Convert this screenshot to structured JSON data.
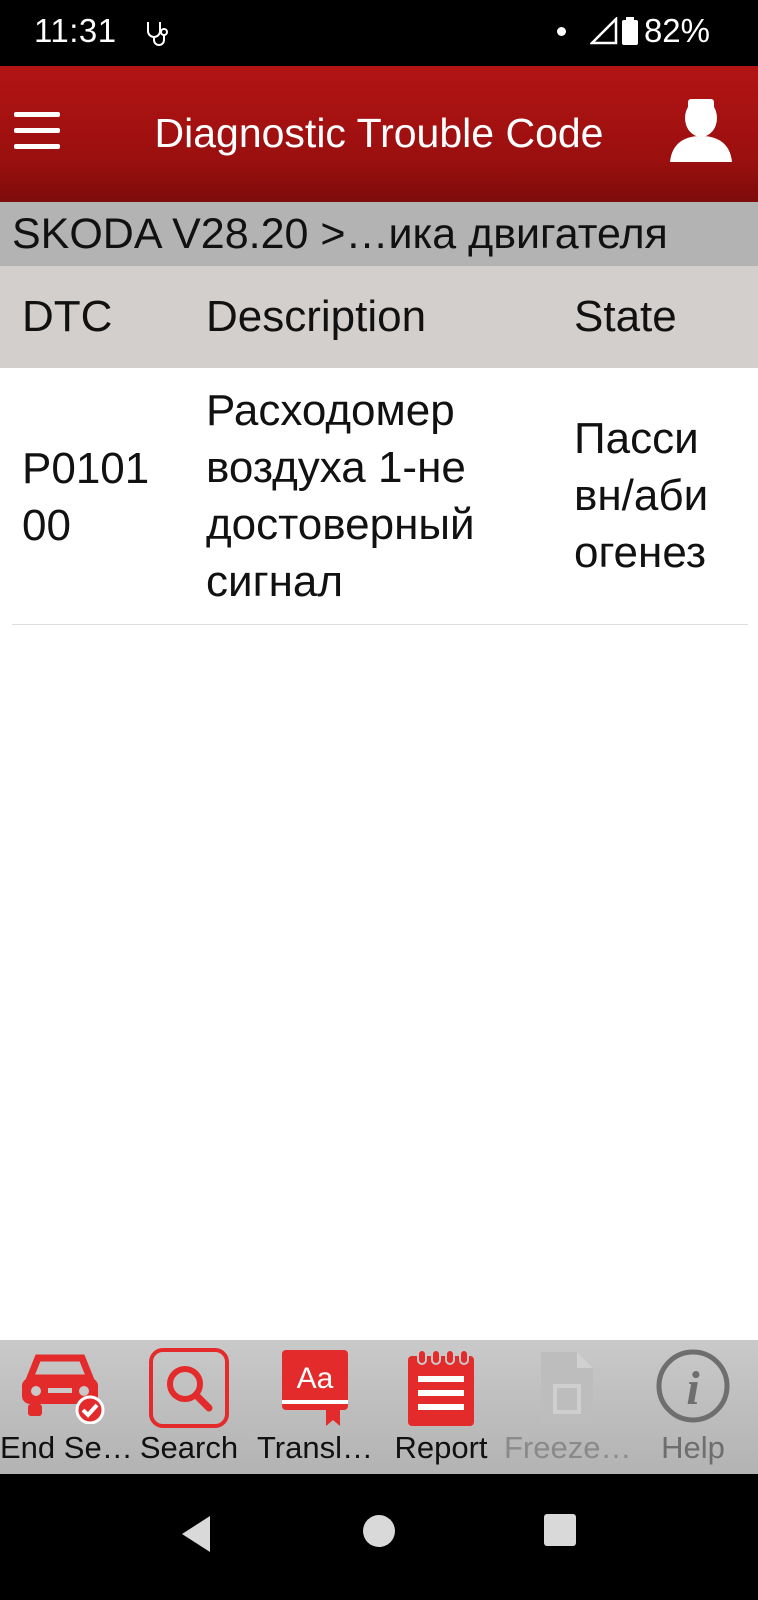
{
  "status_bar": {
    "time": "11:31",
    "battery": "82%"
  },
  "app_bar": {
    "title": "Diagnostic Trouble Code",
    "menu_icon": "hamburger-icon",
    "user_icon": "user-icon"
  },
  "breadcrumb": "SKODA V28.20 >…ика двигателя",
  "table": {
    "headers": {
      "dtc": "DTC",
      "description": "Description",
      "state": "State"
    },
    "rows": [
      {
        "dtc": "P0101\n00",
        "description": "Расходомер\nвоздуха 1-не\nдостоверный\nсигнал",
        "state": "Пасси\nвн/аби\nогенез"
      }
    ]
  },
  "toolbar": {
    "end_session": "End Se…",
    "search": "Search",
    "translate": "Transl…",
    "report": "Report",
    "freeze": "Freeze…",
    "help": "Help"
  },
  "colors": {
    "accent": "#a31212",
    "icon_red": "#e32b2b",
    "disabled": "#8a8a8a"
  }
}
